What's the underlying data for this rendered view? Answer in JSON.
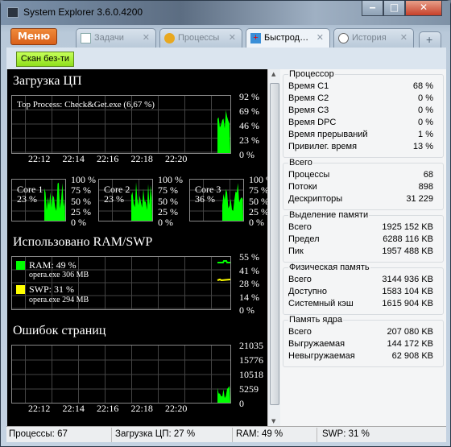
{
  "window": {
    "title": "System Explorer 3.6.0.4200",
    "minimize": "‒",
    "maximize": "□",
    "close": "✕"
  },
  "menu_label": "Меню",
  "tabs": [
    {
      "label": "Задачи",
      "icon": "tasks-icon"
    },
    {
      "label": "Процессы",
      "icon": "gear-icon"
    },
    {
      "label": "Быстрод…",
      "icon": "performance-icon",
      "active": true
    },
    {
      "label": "История",
      "icon": "clock-icon"
    }
  ],
  "add_tab": "+",
  "toolbar": {
    "scan_label": "Скан без-ти"
  },
  "cpu": {
    "title": "Загрузка ЦП",
    "top_process": "Top Process: Check&Get.exe (6,67 %)",
    "y_ticks": [
      "92 %",
      "69 %",
      "46 %",
      "23 %",
      "0 %"
    ],
    "x_ticks": [
      "22:12",
      "22:14",
      "22:16",
      "22:18",
      "22:20"
    ],
    "cores": [
      {
        "name": "Core 1",
        "value": "23 %"
      },
      {
        "name": "Core 2",
        "value": "23 %"
      },
      {
        "name": "Core 3",
        "value": "36 %"
      }
    ],
    "core_ticks": [
      "100 %",
      "75 %",
      "50 %",
      "25 %",
      "0 %"
    ]
  },
  "ram": {
    "title": "Использовано RAM/SWP",
    "ram_label": "RAM: 49 %",
    "ram_proc": "opera.exe 306 MB",
    "swp_label": "SWP: 31 %",
    "swp_proc": "opera.exe 294 MB",
    "y_ticks": [
      "55 %",
      "41 %",
      "28 %",
      "14 %",
      "0 %"
    ],
    "ram_color": "#00ff00",
    "swp_color": "#ffff00"
  },
  "faults": {
    "title": "Ошибок страниц",
    "y_ticks": [
      "21035",
      "15776",
      "10518",
      "5259",
      "0"
    ],
    "x_ticks": [
      "22:12",
      "22:14",
      "22:16",
      "22:18",
      "22:20"
    ]
  },
  "groups": [
    {
      "title": "Процессор",
      "rows": [
        [
          "Время C1",
          "68 %"
        ],
        [
          "Время C2",
          "0 %"
        ],
        [
          "Время C3",
          "0 %"
        ],
        [
          "Время DPC",
          "0 %"
        ],
        [
          "Время прерываний",
          "1 %"
        ],
        [
          "Привилег. время",
          "13 %"
        ]
      ]
    },
    {
      "title": "Всего",
      "rows": [
        [
          "Процессы",
          "68"
        ],
        [
          "Потоки",
          "898"
        ],
        [
          "Дескрипторы",
          "31 229"
        ]
      ]
    },
    {
      "title": "Выделение памяти",
      "rows": [
        [
          "Всего",
          "1925 152 KB"
        ],
        [
          "Предел",
          "6288 116 KB"
        ],
        [
          "Пик",
          "1957 488 KB"
        ]
      ]
    },
    {
      "title": "Физическая память",
      "rows": [
        [
          "Всего",
          "3144 936 KB"
        ],
        [
          "Доступно",
          "1583 104 KB"
        ],
        [
          "Системный кэш",
          "1615 904 KB"
        ]
      ]
    },
    {
      "title": "Память ядра",
      "rows": [
        [
          "Всего",
          "207 080 KB"
        ],
        [
          "Выгружаемая",
          "144 172 KB"
        ],
        [
          "Невыгружаемая",
          "62 908 KB"
        ]
      ]
    }
  ],
  "status": {
    "processes": "Процессы: 67",
    "cpu": "Загрузка ЦП: 27 %",
    "ram": "RAM: 49 %",
    "swp": "SWP: 31 %"
  }
}
